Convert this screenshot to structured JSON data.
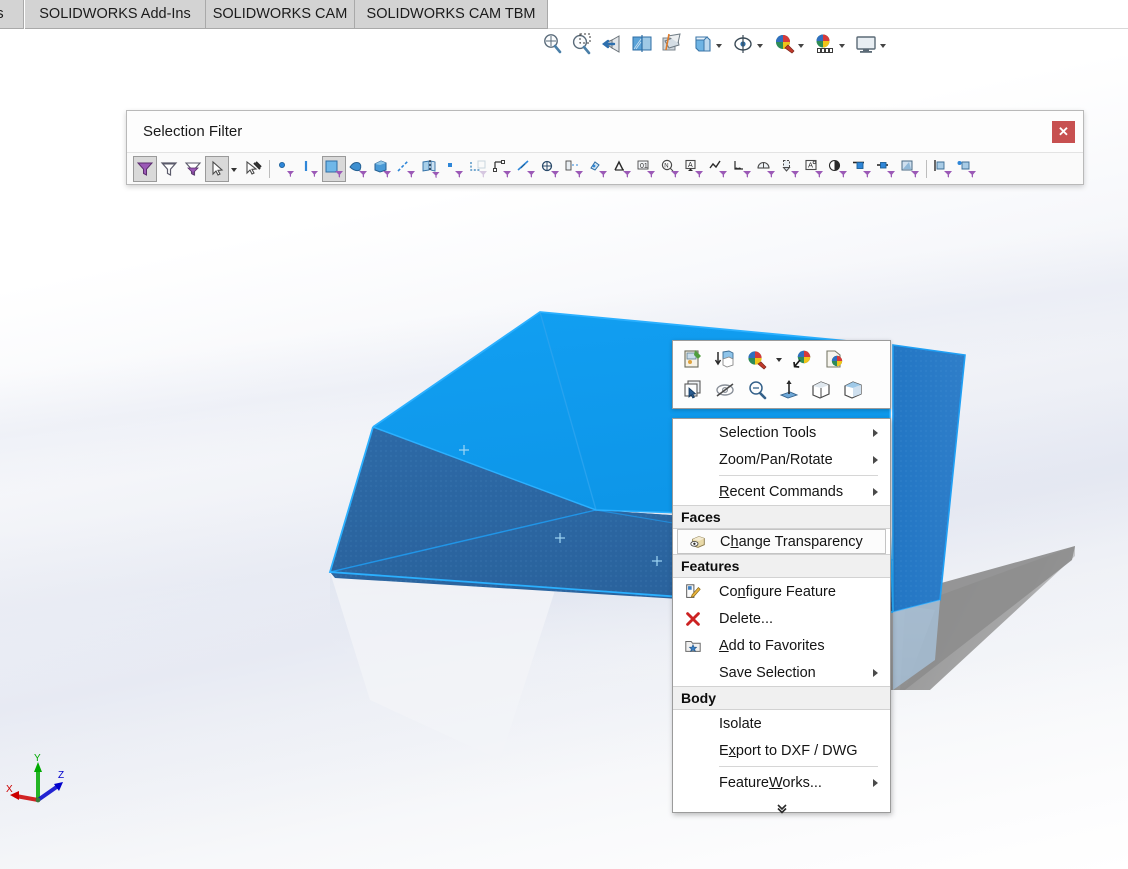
{
  "app": {
    "name": "SOLIDWORKS",
    "viewport_bg_top": "#ffffff",
    "viewport_bg_mid": "#e7eaf3"
  },
  "tabs": [
    {
      "label": "ons",
      "name": "tab-options-truncated"
    },
    {
      "label": "SOLIDWORKS Add-Ins",
      "name": "tab-solidworks-add-ins"
    },
    {
      "label": "SOLIDWORKS CAM",
      "name": "tab-solidworks-cam"
    },
    {
      "label": "SOLIDWORKS CAM TBM",
      "name": "tab-solidworks-cam-tbm"
    }
  ],
  "command_toolbar": {
    "items": [
      {
        "icon": "zoom-to-fit-icon",
        "dropdown": false
      },
      {
        "icon": "zoom-to-area-icon",
        "dropdown": false
      },
      {
        "icon": "previous-view-icon",
        "dropdown": false
      },
      {
        "icon": "section-view-icon",
        "dropdown": false
      },
      {
        "icon": "view-orientation-icon",
        "dropdown": false
      },
      {
        "icon": "display-style-icon",
        "dropdown": true
      },
      {
        "icon": "hide-show-items-icon",
        "dropdown": true
      },
      {
        "icon": "edit-appearance-icon",
        "dropdown": true
      },
      {
        "icon": "apply-scene-icon",
        "dropdown": true
      },
      {
        "icon": "view-settings-icon",
        "dropdown": true
      }
    ]
  },
  "selection_filter": {
    "title": "Selection Filter",
    "close_label": "✕",
    "close_color": "#c75050",
    "buttons": [
      {
        "name": "filter-on-icon",
        "active": true
      },
      {
        "name": "clear-all-filters-icon",
        "active": false
      },
      {
        "name": "invert-selection-icon",
        "active": false
      },
      {
        "name": "select-pointer-icon",
        "active": false,
        "dropdown": true
      },
      {
        "name": "select-over-geometry-icon",
        "active": false
      },
      {
        "sep": true
      },
      {
        "name": "filter-vertices-icon",
        "active": false
      },
      {
        "name": "filter-edges-icon",
        "active": false
      },
      {
        "name": "filter-faces-icon",
        "active": true
      },
      {
        "name": "filter-surface-bodies-icon",
        "active": false
      },
      {
        "name": "filter-solid-bodies-icon",
        "active": false
      },
      {
        "name": "filter-axes-icon",
        "active": false
      },
      {
        "name": "filter-planes-icon",
        "active": false
      },
      {
        "name": "filter-sketch-points-icon",
        "active": false
      },
      {
        "name": "filter-sketch-segments-icon",
        "active": false
      },
      {
        "name": "filter-midpoints-icon",
        "active": false
      },
      {
        "name": "filter-center-marks-icon",
        "active": false
      },
      {
        "name": "filter-centerlines-icon",
        "active": false
      },
      {
        "name": "filter-dimensions-icon",
        "active": false
      },
      {
        "name": "filter-hole-callouts-icon",
        "active": false
      },
      {
        "name": "filter-surface-finish-icon",
        "active": false
      },
      {
        "name": "filter-notes-icon",
        "active": false
      },
      {
        "name": "filter-balloons-icon",
        "active": false
      },
      {
        "name": "filter-datum-target-icon",
        "active": false
      },
      {
        "name": "filter-datum-feature-icon",
        "active": false
      },
      {
        "name": "filter-weld-symbols-icon",
        "active": false
      },
      {
        "name": "filter-weld-beads-icon",
        "active": false
      },
      {
        "name": "filter-block-icon",
        "active": false
      },
      {
        "name": "filter-annotation-icon",
        "active": false
      },
      {
        "name": "filter-cosmetic-thread-icon",
        "active": false
      },
      {
        "name": "filter-blocks2-icon",
        "active": false
      },
      {
        "name": "filter-blocks3-icon",
        "active": false
      },
      {
        "name": "filter-dowel-pin-icon",
        "active": false
      },
      {
        "name": "filter-weldment-icon",
        "active": false
      },
      {
        "name": "filter-point-weld-icon",
        "active": false
      }
    ]
  },
  "mini_toolbar": {
    "row1": [
      {
        "name": "edit-feature-icon",
        "dropdown": false
      },
      {
        "name": "insert-into-new-part-icon",
        "dropdown": false
      },
      {
        "name": "appearances-icon",
        "dropdown": true
      },
      {
        "name": "remove-appearance-icon",
        "dropdown": false
      },
      {
        "name": "copy-appearance-icon",
        "dropdown": false
      }
    ],
    "row2": [
      {
        "name": "select-other-icon",
        "dropdown": false
      },
      {
        "name": "hide-icon",
        "dropdown": false
      },
      {
        "name": "zoom-to-selection-icon",
        "dropdown": false
      },
      {
        "name": "normal-to-icon",
        "dropdown": false
      },
      {
        "name": "isolate-body-icon",
        "dropdown": false
      },
      {
        "name": "change-transparency-icon",
        "dropdown": false
      }
    ]
  },
  "context_menu": {
    "groups": [
      {
        "type": "items",
        "items": [
          {
            "label": "Selection Tools",
            "submenu": true,
            "icon": null,
            "underline": null
          },
          {
            "label": "Zoom/Pan/Rotate",
            "submenu": true,
            "icon": null,
            "underline": null
          },
          {
            "separator_before": true,
            "label": "Recent Commands",
            "submenu": true,
            "icon": null,
            "underline": "R"
          }
        ]
      },
      {
        "type": "header",
        "label": "Faces",
        "items": [
          {
            "label": "Change Transparency",
            "submenu": false,
            "icon": "transparency-icon",
            "boxed": true,
            "underline": "h"
          }
        ]
      },
      {
        "type": "header",
        "label": "Features",
        "items": [
          {
            "label": "Configure Feature",
            "submenu": false,
            "icon": "configure-feature-icon",
            "underline": "n"
          },
          {
            "label": "Delete...",
            "submenu": false,
            "icon": "delete-icon",
            "underline": null
          },
          {
            "label": "Add to Favorites",
            "submenu": false,
            "icon": "favorites-icon",
            "underline": "A"
          },
          {
            "label": "Save Selection",
            "submenu": true,
            "icon": null,
            "underline": null
          }
        ]
      },
      {
        "type": "header",
        "label": "Body",
        "items": [
          {
            "label": "Isolate",
            "submenu": false,
            "icon": null,
            "underline": null
          },
          {
            "label": "Export to DXF / DWG",
            "submenu": false,
            "icon": null,
            "underline": "x"
          },
          {
            "separator_before": true,
            "label": "FeatureWorks...",
            "submenu": true,
            "icon": null,
            "underline": "W"
          }
        ]
      }
    ],
    "expand_glyph": "⌄"
  },
  "model": {
    "selected_color_top": "#0f9df0",
    "selected_color_side": "#2f6aa8",
    "edge_color": "#1c9bf0",
    "shadow_color": "#8c8c8c",
    "state": "selected"
  },
  "triad": {
    "x_label": "X",
    "x_color": "#cc0000",
    "y_label": "Y",
    "y_color": "#00aa00",
    "z_label": "Z",
    "z_color": "#0000cc"
  }
}
